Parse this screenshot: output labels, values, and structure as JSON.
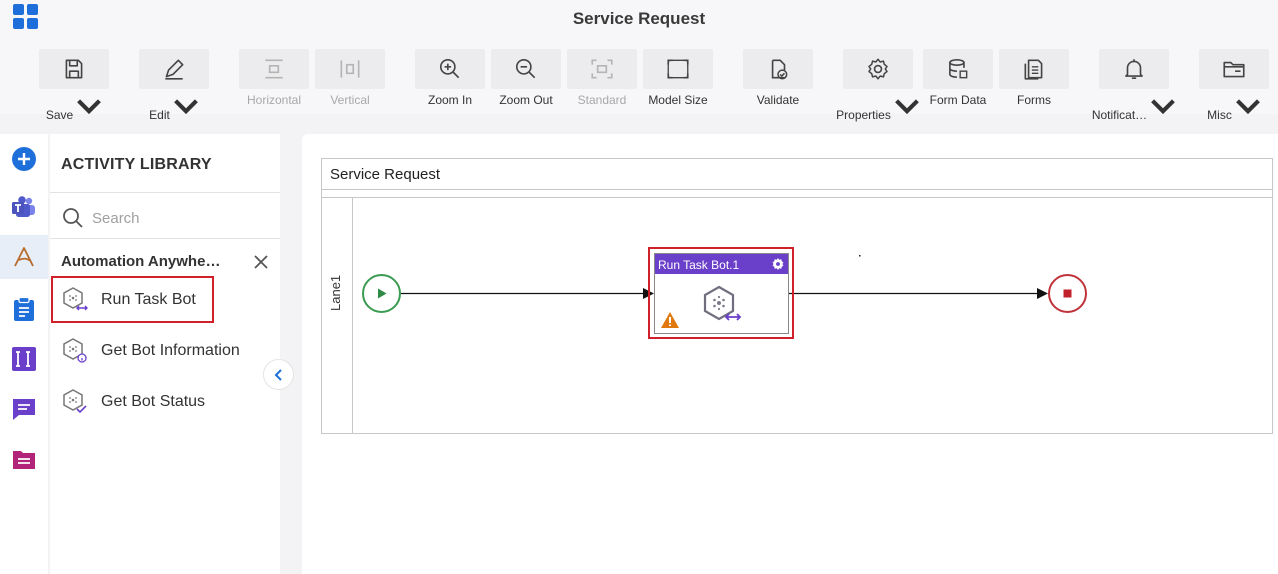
{
  "header": {
    "title": "Service Request"
  },
  "toolbar": {
    "save": "Save",
    "edit": "Edit",
    "horizontal": "Horizontal",
    "vertical": "Vertical",
    "zoom_in": "Zoom In",
    "zoom_out": "Zoom Out",
    "standard": "Standard",
    "model_size": "Model Size",
    "validate": "Validate",
    "properties": "Properties",
    "form_data": "Form Data",
    "forms": "Forms",
    "notifications": "Notificat…",
    "misc": "Misc"
  },
  "rail": {
    "items": [
      "add-icon",
      "teams-icon",
      "automation-anywhere-icon",
      "clipboard-icon",
      "text-field-icon",
      "chat-icon",
      "document-icon"
    ]
  },
  "library": {
    "title": "ACTIVITY LIBRARY",
    "search_placeholder": "Search",
    "group": "Automation Anywhe…",
    "items": [
      {
        "label": "Run Task Bot",
        "icon": "bot-run-icon"
      },
      {
        "label": "Get Bot Information",
        "icon": "bot-info-icon"
      },
      {
        "label": "Get Bot Status",
        "icon": "bot-status-icon"
      }
    ]
  },
  "canvas": {
    "pool_title": "Service Request",
    "lane": "Lane1",
    "task_title": "Run Task Bot.1"
  },
  "colors": {
    "accent": "#1e6fd9",
    "task_header": "#6a3fc9",
    "start": "#3a9b52",
    "end": "#c0333a",
    "highlight": "#d0202a",
    "warning": "#e07a10"
  }
}
